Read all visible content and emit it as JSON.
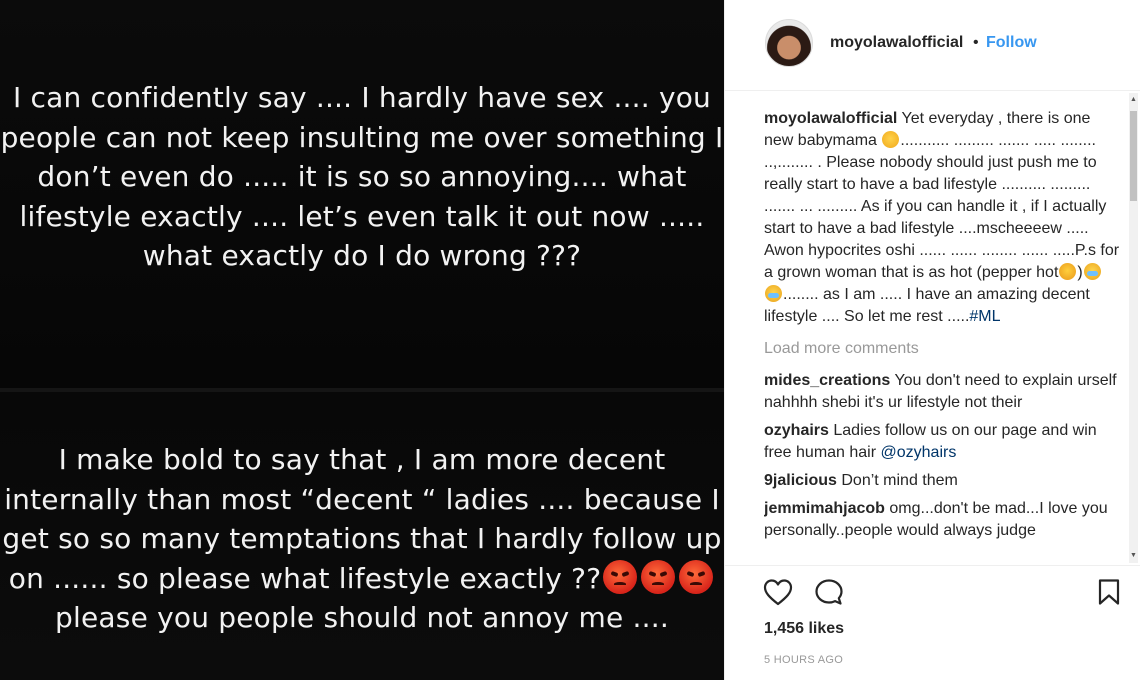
{
  "media": {
    "top_text": "I can confidently say .... I hardly have sex .... you people can not keep insulting me over something I don’t even do ..... it is so so annoying.... what lifestyle exactly .... let’s even talk it out now ..... what exactly do I do wrong ???",
    "bottom_text_1": "I make bold to say that , I am more decent internally than most “decent “ ladies .... because I get so so many temptations that I hardly follow up on ...... so please what lifestyle exactly ??",
    "bottom_text_2": "please you people should not annoy me ....",
    "emoji_names": [
      "angry-face-icon",
      "angry-face-icon",
      "angry-face-icon"
    ]
  },
  "header": {
    "username": "moyolawalofficial",
    "separator": "•",
    "follow_label": "Follow"
  },
  "caption": {
    "username": "moyolawalofficial",
    "text_1": "Yet everyday , there is one new babymama",
    "text_2": "........... ......... ....... ..... ........ ..,........ . Please nobody should just push me to really start to have a bad lifestyle .......... ......... ....... ... ......... As if you can handle it , if I actually start to have a bad lifestyle ....mscheeeew ..... Awon hypocrites oshi ...... ...... ........ ...... .....P.s for a grown woman that is as hot (pepper hot",
    "text_3": ")",
    "text_4": "........ as I am ..... I have an amazing decent lifestyle .... So let me rest .....",
    "hashtag": "#ML"
  },
  "load_more_label": "Load more comments",
  "comments": [
    {
      "username": "mides_creations",
      "text": "You don't need to explain urself nahhhh shebi it's ur lifestyle not their",
      "mention": ""
    },
    {
      "username": "ozyhairs",
      "text": "Ladies follow us on our page and win free human hair",
      "mention": "@ozyhairs"
    },
    {
      "username": "9jalicious",
      "text": "Don’t mind them",
      "mention": ""
    },
    {
      "username": "jemmimahjacob",
      "text": "omg...don't be mad...I love you personally..people would always judge",
      "mention": ""
    }
  ],
  "footer": {
    "likes": "1,456 likes",
    "timestamp": "5 HOURS AGO"
  },
  "colors": {
    "accent": "#3897f0",
    "hashtag": "#003569",
    "muted": "#999999"
  }
}
